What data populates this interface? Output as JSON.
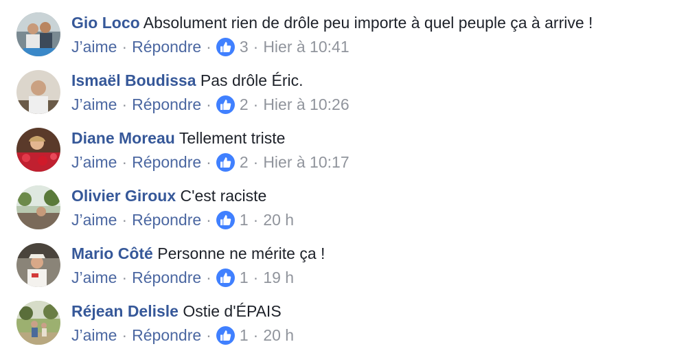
{
  "labels": {
    "like": "J’aime",
    "reply": "Répondre",
    "separator": "·"
  },
  "colors": {
    "author": "#365899",
    "action": "#4b67a1",
    "meta": "#90949c",
    "like_badge": "#4080ff"
  },
  "comments": [
    {
      "author": "Gio Loco",
      "text": "Absolument rien de drôle peu importe à quel peuple ça à arrive !",
      "likes": "3",
      "time": "Hier à 10:41"
    },
    {
      "author": "Ismaël Boudissa",
      "text": "Pas drôle Éric.",
      "likes": "2",
      "time": "Hier à 10:26"
    },
    {
      "author": "Diane Moreau",
      "text": "Tellement triste",
      "likes": "2",
      "time": "Hier à 10:17"
    },
    {
      "author": "Olivier Giroux",
      "text": "C'est raciste",
      "likes": "1",
      "time": "20 h"
    },
    {
      "author": "Mario Côté",
      "text": "Personne ne mérite ça !",
      "likes": "1",
      "time": "19 h"
    },
    {
      "author": "Réjean Delisle",
      "text": "Ostie d'ÉPAIS",
      "likes": "1",
      "time": "20 h"
    }
  ]
}
